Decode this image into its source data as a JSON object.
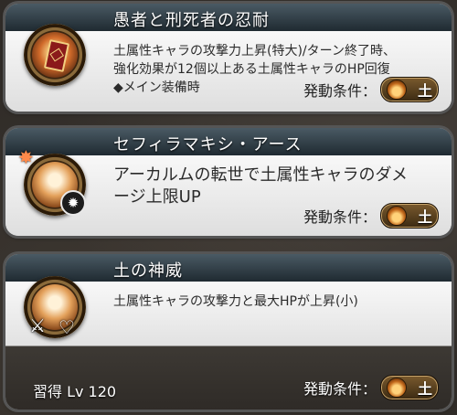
{
  "skills": [
    {
      "name": "愚者と刑死者の忍耐",
      "description_lines": [
        "土属性キャラの攻撃力上昇(特大)/ターン終了時、",
        "強化効果が12個以上ある土属性キャラのHP回復",
        "◆メイン装備時"
      ],
      "condition_label": "発動条件：",
      "condition_element": "土",
      "icon": "tarot-card-icon"
    },
    {
      "name": "セフィラマキシ・アース",
      "description_lines": [
        "アーカルムの転世で土属性キャラのダメ",
        "ージ上限UP"
      ],
      "condition_label": "発動条件：",
      "condition_element": "土",
      "icon": "earth-crest-icon"
    },
    {
      "name": "土の神威",
      "description_lines": [
        "土属性キャラの攻撃力と最大HPが上昇(小)"
      ],
      "condition_label": "発動条件：",
      "condition_element": "土",
      "learn_text": "習得 Lv 120",
      "icon": "earth-aura-icon"
    }
  ],
  "colors": {
    "header": "#2c3a42",
    "card_body": "#ececec",
    "badge": "#5a3e1c"
  }
}
